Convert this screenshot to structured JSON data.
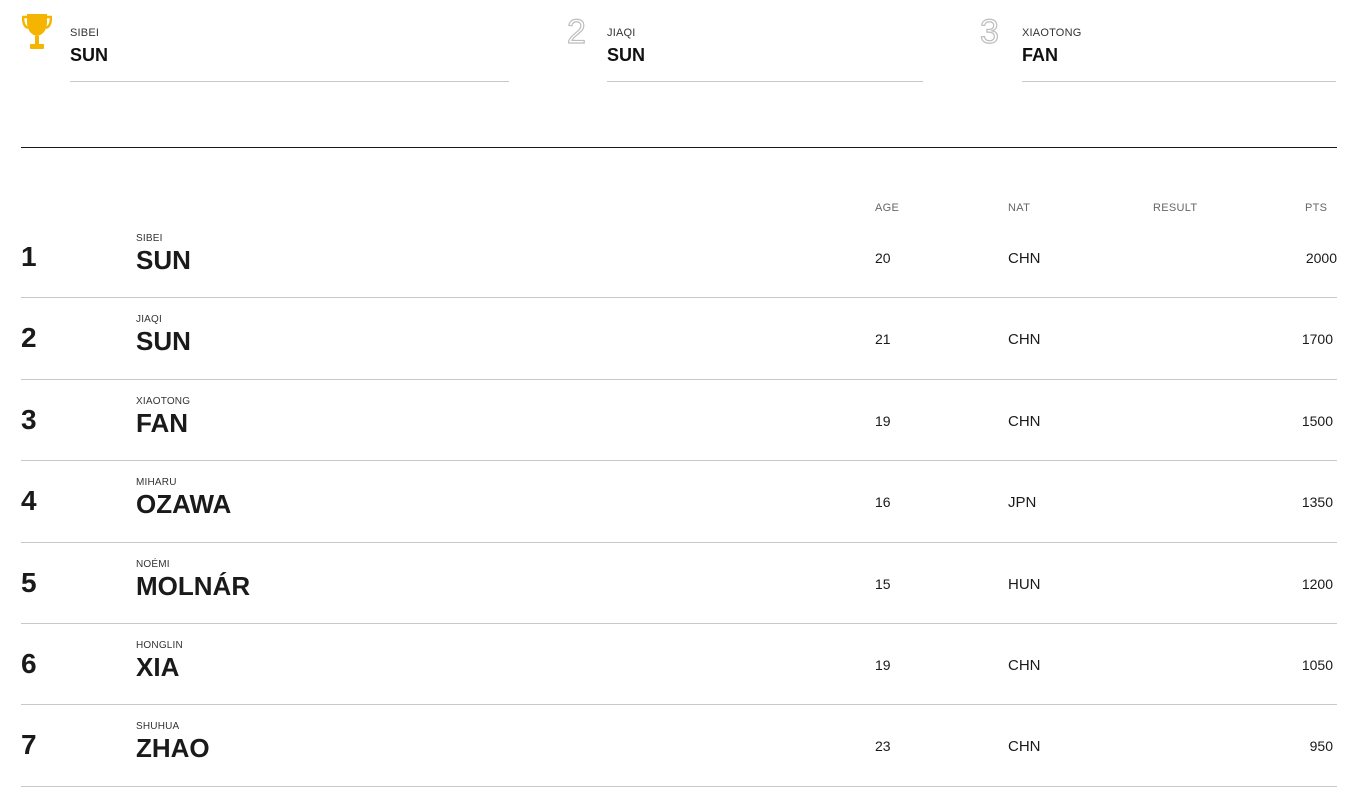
{
  "colors": {
    "trophy": "#f5b400",
    "outline_numeral": "#bdbdbd",
    "text": "#1a1a1a",
    "divider": "#1a1a1a",
    "row_border": "#c8c8c8"
  },
  "podium": [
    {
      "place_icon": "trophy-icon",
      "first_name": "SIBEI",
      "last_name": "SUN"
    },
    {
      "place_numeral": "2",
      "first_name": "JIAQI",
      "last_name": "SUN"
    },
    {
      "place_numeral": "3",
      "first_name": "XIAOTONG",
      "last_name": "FAN"
    }
  ],
  "table": {
    "headers": {
      "age": "AGE",
      "nat": "NAT",
      "result": "RESULT",
      "pts": "PTS"
    },
    "rows": [
      {
        "rank": "1",
        "first_name": "SIBEI",
        "last_name": "SUN",
        "age": "20",
        "nat": "CHN",
        "result": "",
        "pts": "2000"
      },
      {
        "rank": "2",
        "first_name": "JIAQI",
        "last_name": "SUN",
        "age": "21",
        "nat": "CHN",
        "result": "",
        "pts": "1700"
      },
      {
        "rank": "3",
        "first_name": "XIAOTONG",
        "last_name": "FAN",
        "age": "19",
        "nat": "CHN",
        "result": "",
        "pts": "1500"
      },
      {
        "rank": "4",
        "first_name": "MIHARU",
        "last_name": "OZAWA",
        "age": "16",
        "nat": "JPN",
        "result": "",
        "pts": "1350"
      },
      {
        "rank": "5",
        "first_name": "NOÉMI",
        "last_name": "MOLNÁR",
        "age": "15",
        "nat": "HUN",
        "result": "",
        "pts": "1200"
      },
      {
        "rank": "6",
        "first_name": "HONGLIN",
        "last_name": "XIA",
        "age": "19",
        "nat": "CHN",
        "result": "",
        "pts": "1050"
      },
      {
        "rank": "7",
        "first_name": "SHUHUA",
        "last_name": "ZHAO",
        "age": "23",
        "nat": "CHN",
        "result": "",
        "pts": "950"
      }
    ]
  }
}
